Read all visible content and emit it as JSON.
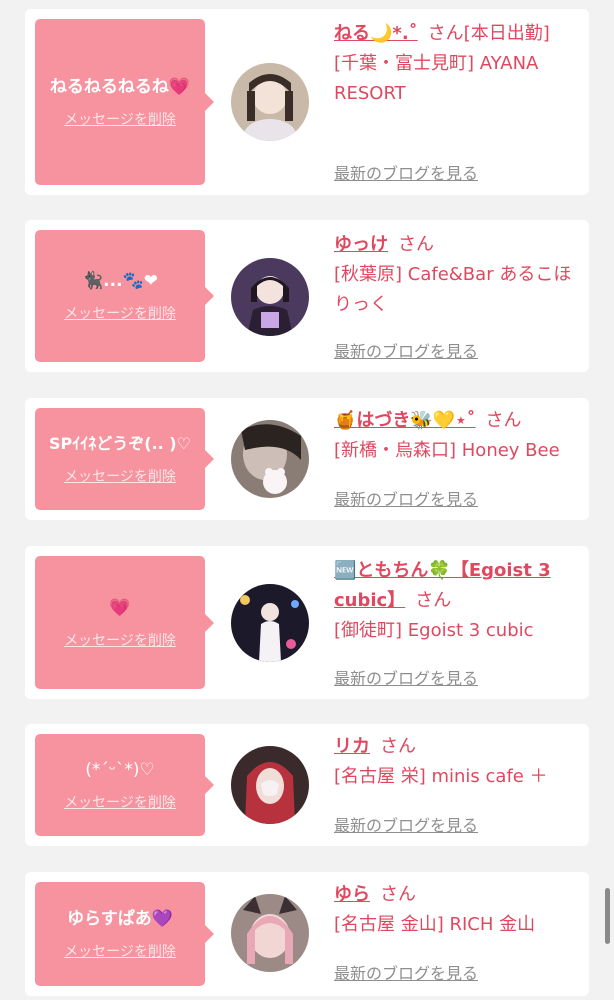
{
  "delete_label": "メッセージを削除",
  "blog_label": "最新のブログを見る",
  "san_label": "さん",
  "colors": {
    "accent": "#e0485f",
    "bubble": "#f6939e",
    "card": "#ffffff",
    "background": "#f2f2f2"
  },
  "messages": [
    {
      "bubble_text": "ねるねるねるね💗",
      "name": "ねる🌙*.˚",
      "suffix": "さん[本日出勤]",
      "shop": "[千葉・富士見町] AYANA RESORT"
    },
    {
      "bubble_text": "🐈‍⬛...🐾❤",
      "name": "ゆっけ",
      "suffix": "さん",
      "shop": "[秋葉原] Cafe&Bar あるこほりっく"
    },
    {
      "bubble_text": "SPｲｲﾈどうぞ(.. )♡",
      "name": "🍯はづき🐝💛⋆˚",
      "suffix": "さん",
      "shop": "[新橋・烏森口] Honey Bee"
    },
    {
      "bubble_text": "💗",
      "name": "🆕ともちん🍀【Egoist 3 cubic】",
      "suffix": "さん",
      "shop": "[御徒町] Egoist 3 cubic"
    },
    {
      "bubble_text": "(*ˊᵕˋ*)♡",
      "name": "リカ",
      "suffix": "さん",
      "shop": "[名古屋 栄] minis cafe ＋"
    },
    {
      "bubble_text": "ゆらすぱあ💜",
      "name": "ゆら",
      "suffix": "さん",
      "shop": "[名古屋 金山] RICH 金山"
    }
  ]
}
